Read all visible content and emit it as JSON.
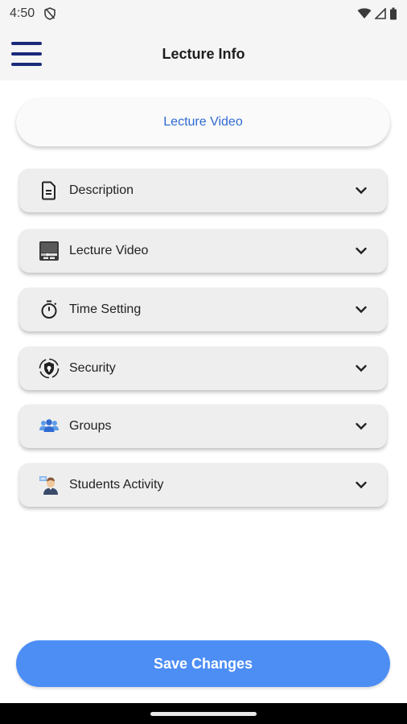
{
  "status_bar": {
    "time": "4:50"
  },
  "app_bar": {
    "title": "Lecture Info"
  },
  "top_pill": {
    "label": "Lecture Video"
  },
  "sections": [
    {
      "label": "Description",
      "icon": "document-icon"
    },
    {
      "label": "Lecture Video",
      "icon": "video-player-icon"
    },
    {
      "label": "Time Setting",
      "icon": "stopwatch-icon"
    },
    {
      "label": "Security",
      "icon": "security-shield-icon"
    },
    {
      "label": "Groups",
      "icon": "groups-icon"
    },
    {
      "label": "Students Activity",
      "icon": "students-activity-icon"
    }
  ],
  "save_button": {
    "label": "Save Changes"
  },
  "colors": {
    "accent": "#4d8ef5",
    "pill_text": "#2f6ad0",
    "menu": "#1a2a7a"
  }
}
